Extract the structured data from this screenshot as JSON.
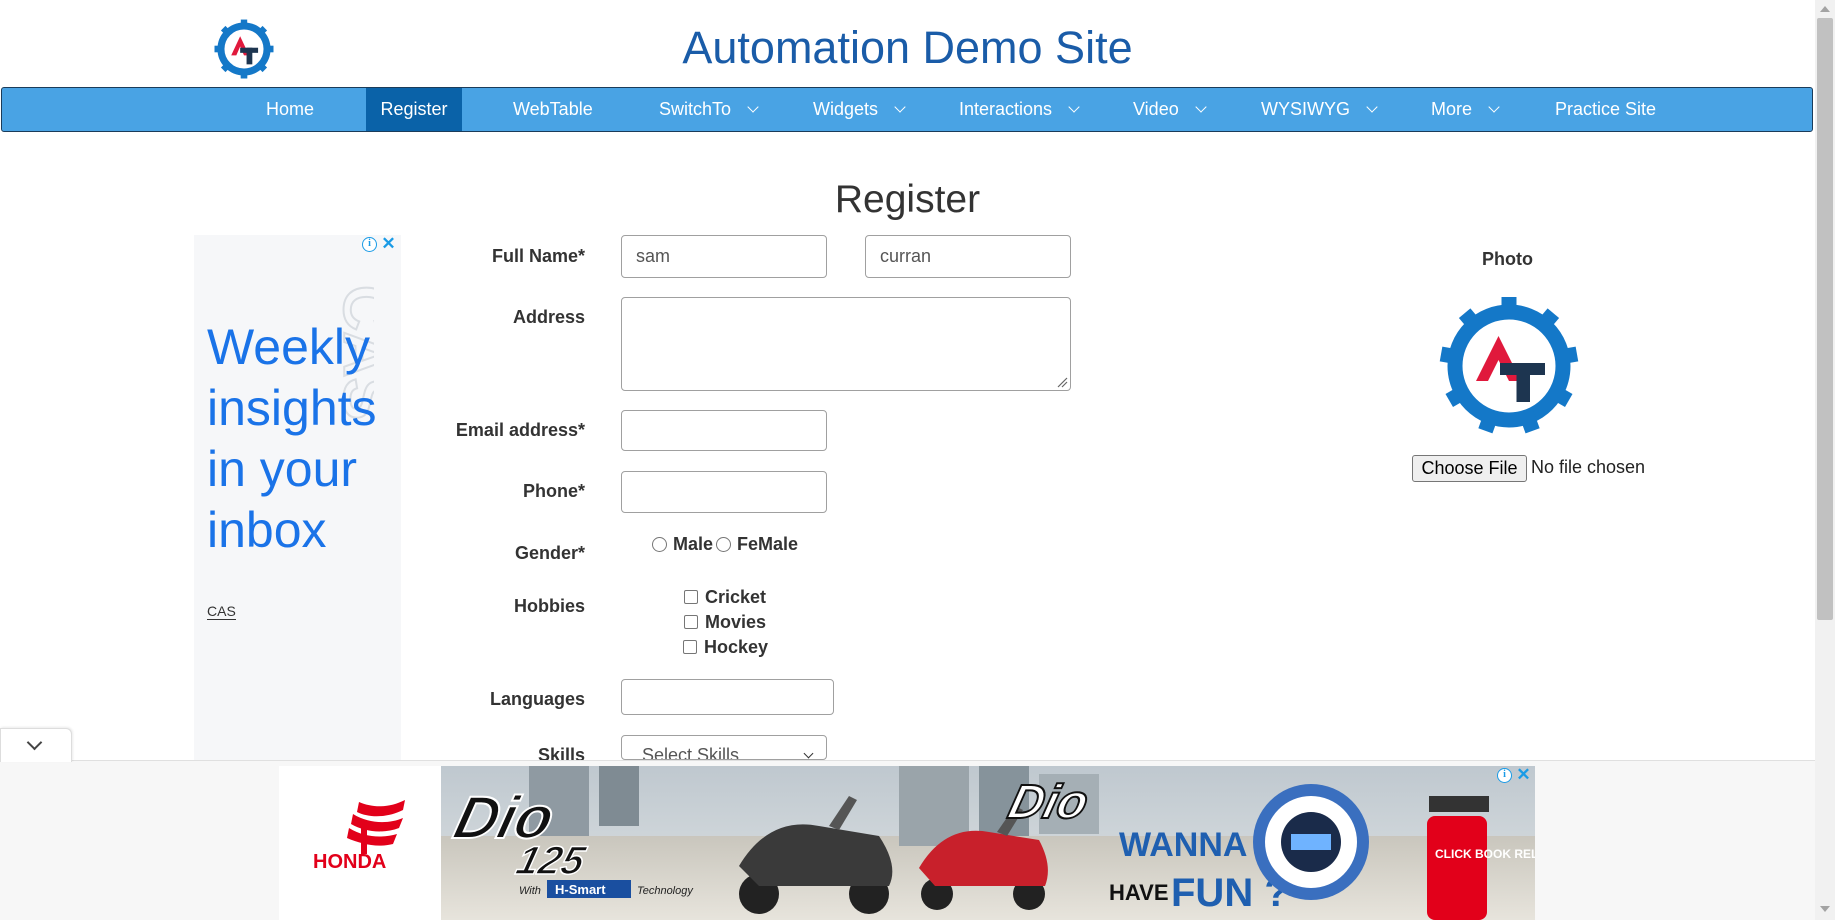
{
  "header": {
    "title": "Automation Demo Site",
    "logo_icon": "gear-at-logo-icon"
  },
  "nav": {
    "items": [
      {
        "label": "Home",
        "dropdown": false
      },
      {
        "label": "Register",
        "dropdown": false,
        "active": true
      },
      {
        "label": "WebTable",
        "dropdown": false
      },
      {
        "label": "SwitchTo",
        "dropdown": true
      },
      {
        "label": "Widgets",
        "dropdown": true
      },
      {
        "label": "Interactions",
        "dropdown": true
      },
      {
        "label": "Video",
        "dropdown": true
      },
      {
        "label": "WYSIWYG",
        "dropdown": true
      },
      {
        "label": "More",
        "dropdown": true
      },
      {
        "label": "Practice Site",
        "dropdown": false
      }
    ],
    "bg_color": "#49a3e4",
    "active_color": "#0a62a8"
  },
  "form": {
    "heading": "Register",
    "full_name_label": "Full Name*",
    "first_name_value": "sam",
    "last_name_value": "curran",
    "address_label": "Address",
    "address_value": "",
    "email_label": "Email address*",
    "email_value": "",
    "phone_label": "Phone*",
    "phone_value": "",
    "gender_label": "Gender*",
    "gender_options": [
      "Male",
      "FeMale"
    ],
    "hobbies_label": "Hobbies",
    "hobbies": [
      "Cricket",
      "Movies",
      "Hockey"
    ],
    "languages_label": "Languages",
    "skills_label": "Skills",
    "skills_selected": "Select Skills"
  },
  "photo": {
    "label": "Photo",
    "button_label": "Choose File",
    "status": "No file chosen"
  },
  "side_ad": {
    "headline": "Weekly insights in your inbox",
    "brand": "CAS",
    "headline_color": "#1a73e8"
  },
  "bottom_ad": {
    "brand": "HONDA",
    "product": "Dio",
    "model_number": "125",
    "tagline_small": "HAVE",
    "tagline_main": "WANNA",
    "tagline_fun": "FUN ?",
    "smart_label": "H-Smart",
    "smart_prefix": "With",
    "smart_suffix": "Technology",
    "cta": "CLICK BOOK RELAX"
  },
  "colors": {
    "title": "#1a5ca8",
    "ad_icon": "#1a9be6",
    "logo_blue": "#1478c8",
    "logo_red": "#e0193c",
    "logo_dark": "#1d3550"
  }
}
